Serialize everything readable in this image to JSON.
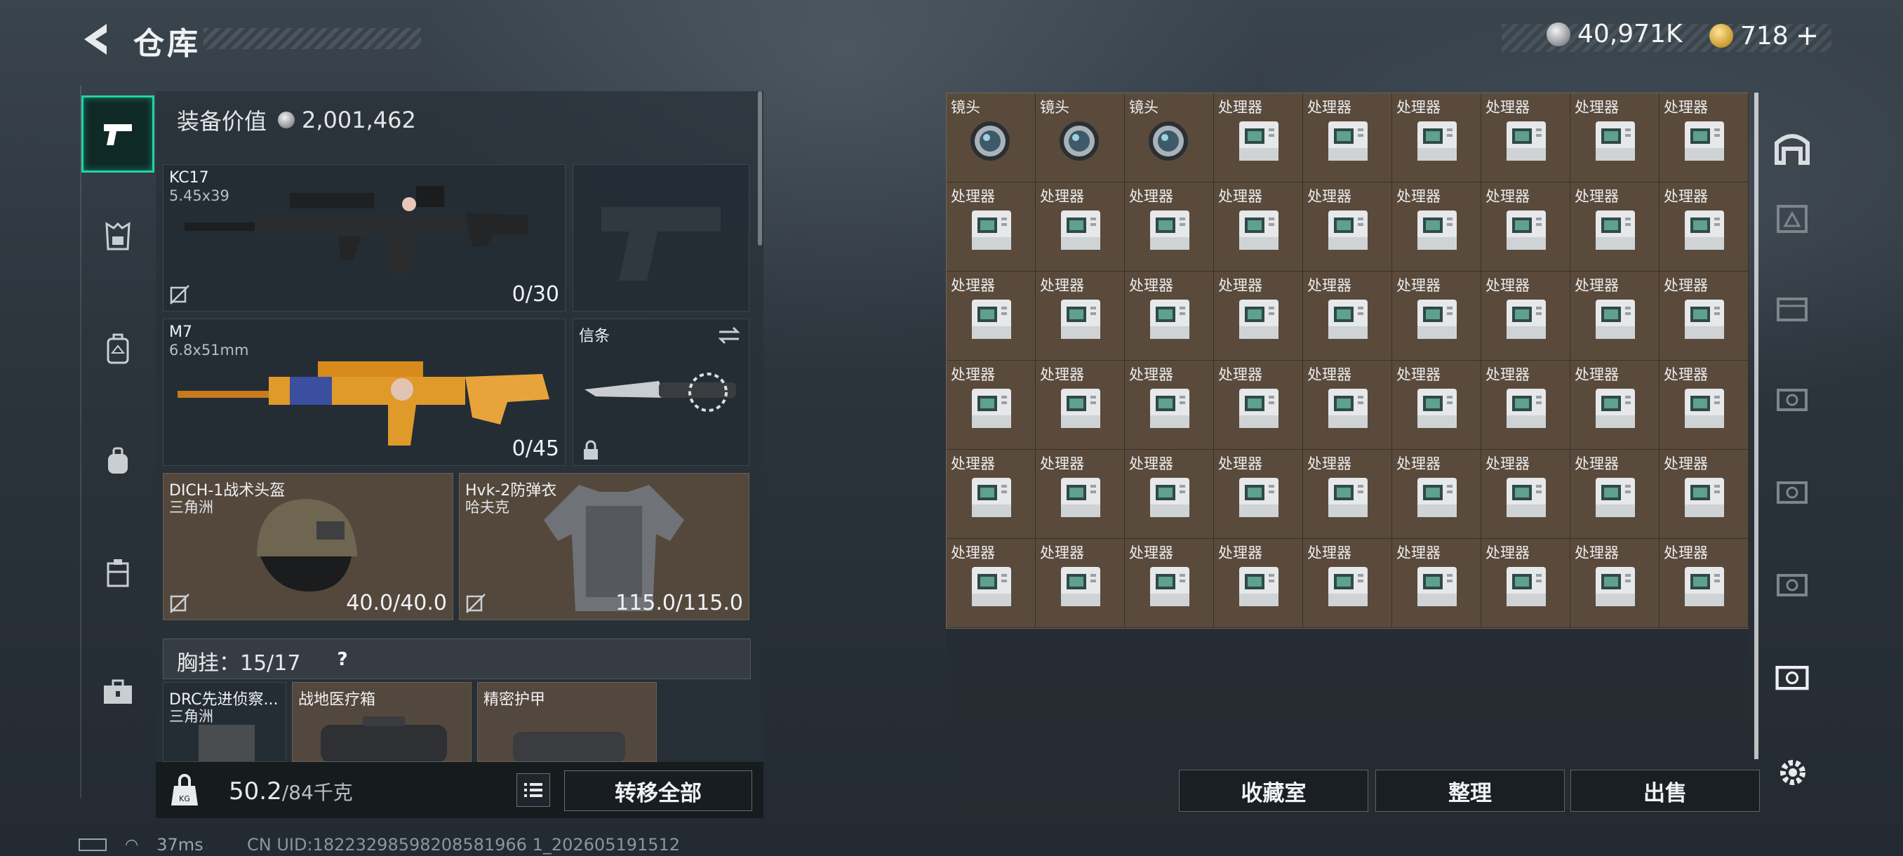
{
  "header": {
    "title": "仓库"
  },
  "currency": {
    "silver": "40,971K",
    "gold": "718",
    "gold_plus": "+"
  },
  "equipment": {
    "value_label": "装备价值",
    "value": "2,001,462",
    "weapons": [
      {
        "name": "KC17",
        "caliber": "5.45x39",
        "ammo": "0/30"
      },
      {
        "name": "M7",
        "caliber": "6.8x51mm",
        "ammo": "0/45"
      }
    ],
    "melee": {
      "name": "信条"
    },
    "helmet": {
      "name": "DICH-1战术头盔",
      "origin": "三角洲",
      "durability": "40.0/40.0"
    },
    "armor": {
      "name": "Hvk-2防弹衣",
      "origin": "哈夫克",
      "durability": "115.0/115.0"
    },
    "chest_rig": {
      "label": "胸挂：",
      "count": "15/17",
      "help": "?"
    },
    "rig_items": [
      {
        "name": "DRC先进侦察...",
        "origin": "三角洲"
      },
      {
        "name": "战地医疗箱"
      },
      {
        "name": "精密护甲"
      }
    ]
  },
  "bottom": {
    "weight": "50.2",
    "weight_max": "/84千克",
    "transfer_label": "转移全部"
  },
  "storage": {
    "cells": [
      "镜头",
      "镜头",
      "镜头",
      "处理器",
      "处理器",
      "处理器",
      "处理器",
      "处理器",
      "处理器",
      "处理器",
      "处理器",
      "处理器",
      "处理器",
      "处理器",
      "处理器",
      "处理器",
      "处理器",
      "处理器",
      "处理器",
      "处理器",
      "处理器",
      "处理器",
      "处理器",
      "处理器",
      "处理器",
      "处理器",
      "处理器",
      "处理器",
      "处理器",
      "处理器",
      "处理器",
      "处理器",
      "处理器",
      "处理器",
      "处理器",
      "处理器",
      "处理器",
      "处理器",
      "处理器",
      "处理器",
      "处理器",
      "处理器",
      "处理器",
      "处理器",
      "处理器",
      "处理器",
      "处理器",
      "处理器",
      "处理器",
      "处理器",
      "处理器",
      "处理器",
      "处理器",
      "处理器"
    ],
    "buttons": {
      "collection": "收藏室",
      "sort": "整理",
      "sell": "出售"
    }
  },
  "statusbar": {
    "ping": "37ms",
    "uid": "CN UID:18223298598208581966 1_202605191512"
  },
  "colors": {
    "accent": "#22d3a6",
    "storage_bg": "#584a3d"
  }
}
